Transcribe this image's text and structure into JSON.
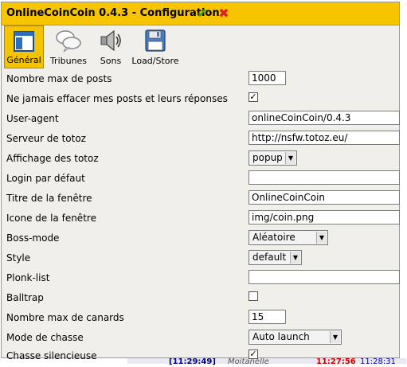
{
  "window": {
    "title": "OnlineCoinCoin 0.4.3 - Configuration",
    "ok_icon": "checkmark-icon",
    "cancel_icon": "close-icon"
  },
  "tabs": [
    {
      "label": "Général",
      "icon": "window-icon",
      "active": true
    },
    {
      "label": "Tribunes",
      "icon": "speech-bubbles-icon",
      "active": false
    },
    {
      "label": "Sons",
      "icon": "speaker-icon",
      "active": false
    },
    {
      "label": "Load/Store",
      "icon": "floppy-disk-icon",
      "active": false
    }
  ],
  "settings": [
    {
      "label": "Nombre max de posts",
      "type": "text",
      "value": "1000"
    },
    {
      "label": "Ne jamais effacer mes posts et leurs réponses",
      "type": "checkbox",
      "checked": true
    },
    {
      "label": "User-agent",
      "type": "text",
      "value": "onlineCoinCoin/0.4.3"
    },
    {
      "label": "Serveur de totoz",
      "type": "text",
      "value": "http://nsfw.totoz.eu/"
    },
    {
      "label": "Affichage des totoz",
      "type": "select",
      "value": "popup"
    },
    {
      "label": "Login par défaut",
      "type": "text",
      "value": ""
    },
    {
      "label": "Titre de la fenêtre",
      "type": "text",
      "value": "OnlineCoinCoin"
    },
    {
      "label": "Icone de la fenêtre",
      "type": "text",
      "value": "img/coin.png"
    },
    {
      "label": "Boss-mode",
      "type": "select",
      "value": "Aléatoire"
    },
    {
      "label": "Style",
      "type": "select",
      "value": "default"
    },
    {
      "label": "Plonk-list",
      "type": "text",
      "value": ""
    },
    {
      "label": "Balltrap",
      "type": "checkbox",
      "checked": false
    },
    {
      "label": "Nombre max de canards",
      "type": "text",
      "value": "15"
    },
    {
      "label": "Mode de chasse",
      "type": "select",
      "value": "Auto launch"
    },
    {
      "label": "Chasse silencieuse",
      "type": "checkbox",
      "checked": true
    }
  ],
  "background": {
    "bottom_time_1": "[11:29:49]",
    "bottom_user": "Moitanelle",
    "bottom_time_2": "11:27:56",
    "bottom_time_3": "11:28:31"
  },
  "colors": {
    "titlebar": "#f7c400",
    "active_tab": "#f5c400",
    "window_bg": "#f1efe9"
  }
}
